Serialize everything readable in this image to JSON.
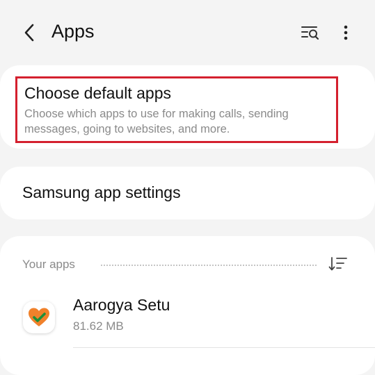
{
  "header": {
    "title": "Apps",
    "back_icon": "back-arrow-icon",
    "search_icon": "list-search-icon",
    "more_icon": "more-vertical-icon"
  },
  "default_apps": {
    "title": "Choose default apps",
    "description": "Choose which apps to use for making calls, sending messages, going to websites, and more.",
    "highlight_color": "#d4202e"
  },
  "samsung_settings": {
    "label": "Samsung app settings"
  },
  "your_apps": {
    "label": "Your apps",
    "sort_icon": "sort-icon",
    "apps": [
      {
        "name": "Aarogya Setu",
        "size": "81.62 MB",
        "icon": "aarogya-setu-heart-icon"
      }
    ]
  }
}
